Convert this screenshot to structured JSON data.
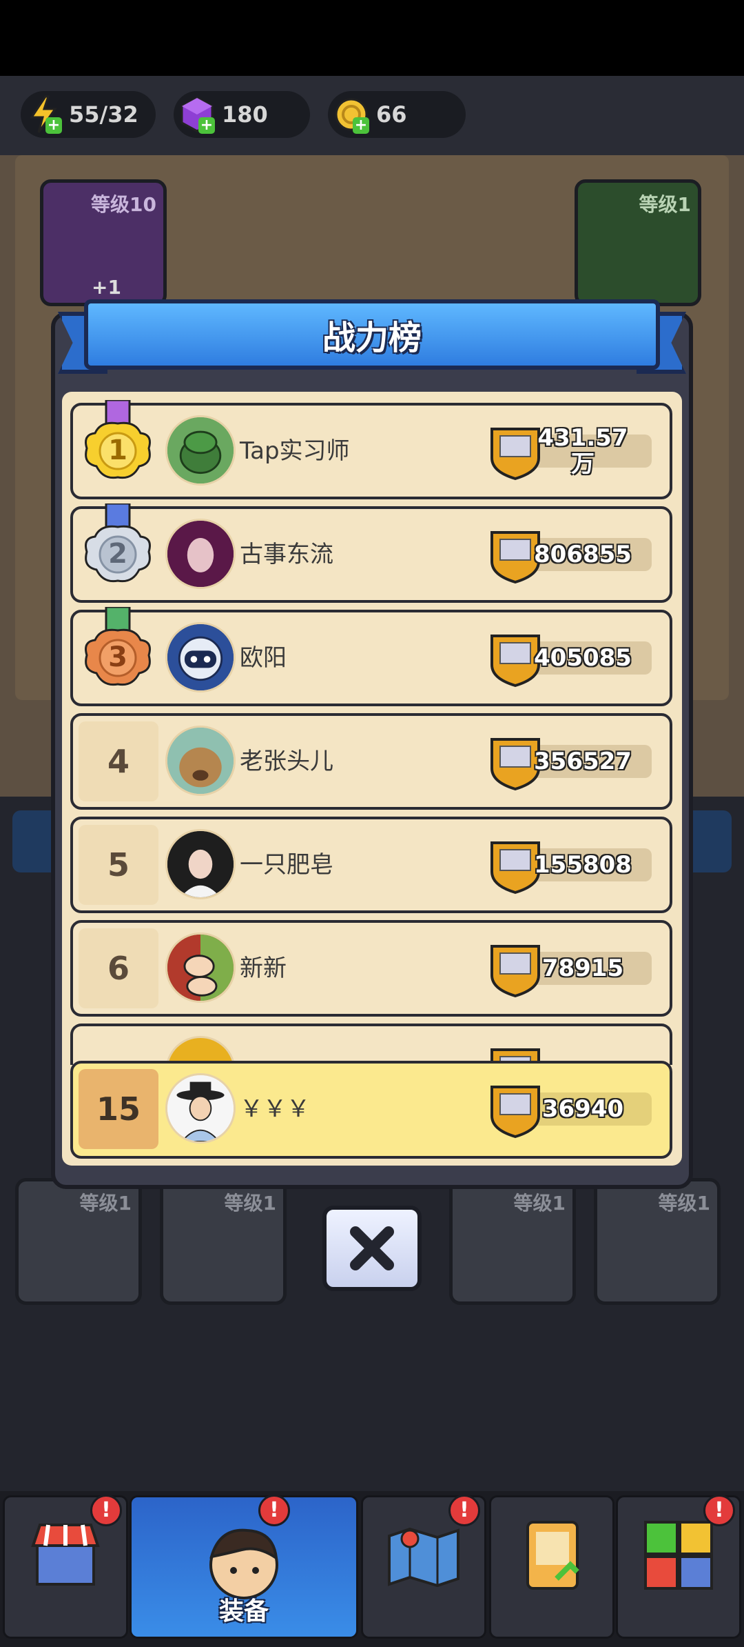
{
  "resources": {
    "energy": "55/32",
    "gems": "180",
    "coins": "66"
  },
  "background": {
    "left_slot_level": "等级10",
    "left_slot_plus": "+1",
    "right_slot_level": "等级1",
    "equip_levels": [
      "等级1",
      "等级1",
      "等级1",
      "等级1"
    ]
  },
  "modal": {
    "title": "战力榜",
    "rows": [
      {
        "rank": "1",
        "name": "Tap实习师",
        "power": "431.57\n万",
        "medal": "gold"
      },
      {
        "rank": "2",
        "name": "古事东流",
        "power": "806855",
        "medal": "silver"
      },
      {
        "rank": "3",
        "name": "欧阳",
        "power": "405085",
        "medal": "bronze"
      },
      {
        "rank": "4",
        "name": "老张头儿",
        "power": "356527"
      },
      {
        "rank": "5",
        "name": "一只肥皂",
        "power": "155808"
      },
      {
        "rank": "6",
        "name": "新新",
        "power": "78915"
      }
    ],
    "self_row": {
      "rank": "15",
      "name": "￥￥￥",
      "power": "36940"
    }
  },
  "nav": {
    "items": [
      {
        "id": "shop",
        "badge": "!"
      },
      {
        "id": "equip",
        "label": "装备",
        "badge": "!"
      },
      {
        "id": "map",
        "badge": "!"
      },
      {
        "id": "card"
      },
      {
        "id": "puzzle",
        "badge": "!"
      }
    ]
  },
  "colors": {
    "ribbon": "#3a8cf0",
    "row_bg": "#f4e5c4",
    "self_row_bg": "#fbe98e",
    "badge": "#e33b3b"
  }
}
